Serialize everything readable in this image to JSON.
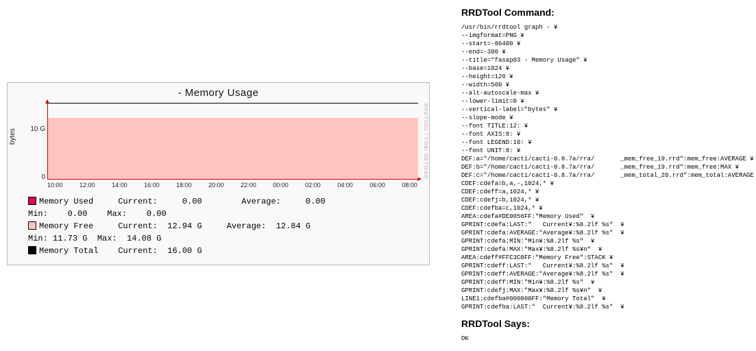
{
  "chart_data": {
    "type": "area",
    "title": " - Memory Usage",
    "ylabel": "bytes",
    "ylim": [
      0,
      16
    ],
    "yticks": [
      0,
      "10 G"
    ],
    "categories": [
      "10:00",
      "12:00",
      "14:00",
      "16:00",
      "18:00",
      "20:00",
      "22:00",
      "00:00",
      "02:00",
      "04:00",
      "06:00",
      "08:00"
    ],
    "series": [
      {
        "name": "Memory Used",
        "color": "#DE0056",
        "values": [
          0,
          0,
          0,
          0,
          0,
          0,
          0,
          0,
          0,
          0,
          0,
          0
        ]
      },
      {
        "name": "Memory Free",
        "color": "#FFC3C0",
        "values": [
          12.9,
          12.9,
          12.9,
          12.9,
          12.9,
          12.9,
          12.9,
          12.9,
          12.6,
          12.7,
          12.8,
          12.9
        ]
      },
      {
        "name": "Memory Total",
        "color": "#000000",
        "values": [
          16,
          16,
          16,
          16,
          16,
          16,
          16,
          16,
          16,
          16,
          16,
          16
        ]
      }
    ]
  },
  "legend": {
    "used": {
      "label": "Memory Used",
      "current": "0.00",
      "average": "0.00",
      "min": "0.00",
      "max": "0.00"
    },
    "free": {
      "label": "Memory Free",
      "current": "12.94 G",
      "average": "12.84 G",
      "min": "11.73 G",
      "max": "14.08 G"
    },
    "total": {
      "label": "Memory Total",
      "current": "16.00 G"
    }
  },
  "labels": {
    "current": "Current:",
    "average": "Average:",
    "min": "Min:",
    "max": "Max:"
  },
  "watermark": "RRDTOOL / TOBI OETIKER",
  "right": {
    "cmd_heading": "RRDTool Command:",
    "says_heading": "RRDTool Says:",
    "says_output": "OK",
    "command": "/usr/bin/rrdtool graph - ¥\n--imgformat=PNG ¥\n--start=-86400 ¥\n--end=-300 ¥\n--title=\"fasap03 - Memory Usage\" ¥\n--base=1024 ¥\n--height=120 ¥\n--width=500 ¥\n--alt-autoscale-max ¥\n--lower-limit=0 ¥\n--vertical-label=\"bytes\" ¥\n--slope-mode ¥\n--font TITLE:12: ¥\n--font AXIS:8: ¥\n--font LEGEND:10: ¥\n--font UNIT:8: ¥\nDEF:a=\"/home/cacti/cacti-0.8.7a/rra/       _mem_free_19.rrd\":mem_free:AVERAGE ¥\nDEF:b=\"/home/cacti/cacti-0.8.7a/rra/       _mem_free_19.rrd\":mem_free:MAX ¥\nDEF:c=\"/home/cacti/cacti-0.8.7a/rra/       _mem_total_20.rrd\":mem_total:AVERAGE ¥\nCDEF:cdefa=b,a,-,1024,* ¥\nCDEF:cdeff=a,1024,* ¥\nCDEF:cdefj=b,1024,* ¥\nCDEF:cdefba=c,1024,* ¥\nAREA:cdefa#DE0056FF:\"Memory Used\"  ¥\nGPRINT:cdefa:LAST:\"   Current¥:%8.2lf %s\"  ¥\nGPRINT:cdefa:AVERAGE:\"Average¥:%8.2lf %s\"  ¥\nGPRINT:cdefa:MIN:\"Min¥:%8.2lf %s\"  ¥\nGPRINT:cdefa:MAX:\"Max¥:%8.2lf %s¥n\"  ¥\nAREA:cdeff#FFC3C0FF:\"Memory Free\":STACK ¥\nGPRINT:cdeff:LAST:\"   Current¥:%8.2lf %s\"  ¥\nGPRINT:cdeff:AVERAGE:\"Average¥:%8.2lf %s\"  ¥\nGPRINT:cdeff:MIN:\"Min¥:%8.2lf %s\"  ¥\nGPRINT:cdefj:MAX:\"Max¥:%8.2lf %s¥n\"  ¥\nLINE1:cdefba#000000FF:\"Memory Total\"  ¥\nGPRINT:cdefba:LAST:\"  Current¥:%8.2lf %s\"  ¥"
  }
}
